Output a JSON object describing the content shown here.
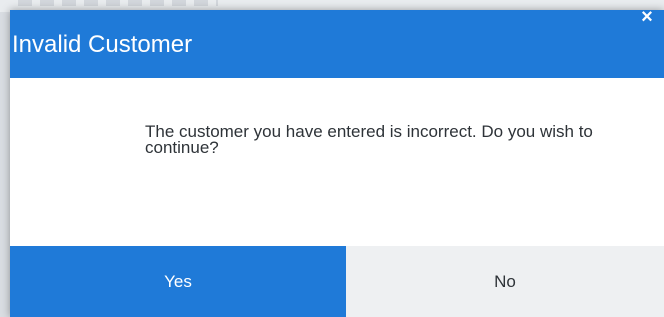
{
  "dialog": {
    "title": "Invalid Customer",
    "close_glyph": "×",
    "message": "The customer you have entered is incorrect. Do you wish to continue?",
    "buttons": {
      "yes_label": "Yes",
      "no_label": "No"
    }
  },
  "icons": {
    "close": "close-icon"
  },
  "colors": {
    "accent": "#1f7ad8",
    "secondary_button": "#eef0f2",
    "text": "#2e3338"
  }
}
